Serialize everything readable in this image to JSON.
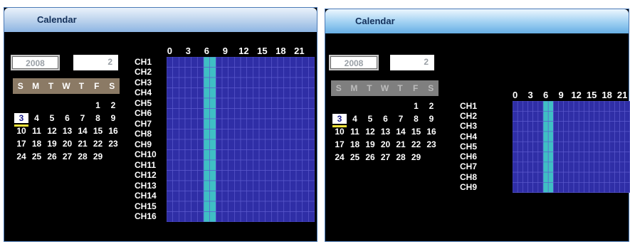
{
  "colors": {
    "cell_unscheduled": "#2f2ea6",
    "cell_scheduled": "#3fbfc4",
    "grid_line": "#5e5ccf",
    "dow_bg_left": "#8b7a65",
    "dow_bg_right": "#7f7f7f",
    "selected_underline": "#f2e23a"
  },
  "left": {
    "title": "Calendar",
    "year": "2008",
    "month": "2",
    "dow": [
      "S",
      "M",
      "T",
      "W",
      "T",
      "F",
      "S"
    ],
    "weeks": [
      [
        "",
        "",
        "",
        "",
        "",
        "1",
        "2"
      ],
      [
        "3",
        "4",
        "5",
        "6",
        "7",
        "8",
        "9"
      ],
      [
        "10",
        "11",
        "12",
        "13",
        "14",
        "15",
        "16"
      ],
      [
        "17",
        "18",
        "19",
        "20",
        "21",
        "22",
        "23"
      ],
      [
        "24",
        "25",
        "26",
        "27",
        "28",
        "29",
        ""
      ]
    ],
    "selected_day": "3",
    "hour_labels": [
      "0",
      "3",
      "6",
      "9",
      "12",
      "15",
      "18",
      "21"
    ],
    "channels": [
      "CH1",
      "CH2",
      "CH3",
      "CH4",
      "CH5",
      "CH6",
      "CH7",
      "CH8",
      "CH9",
      "CH10",
      "CH11",
      "CH12",
      "CH13",
      "CH14",
      "CH15",
      "CH16"
    ],
    "scheduled_hours": [
      6,
      7
    ]
  },
  "right": {
    "title": "Calendar",
    "year": "2008",
    "month": "2",
    "dow": [
      "S",
      "M",
      "T",
      "W",
      "T",
      "F",
      "S"
    ],
    "weeks": [
      [
        "",
        "",
        "",
        "",
        "",
        "1",
        "2"
      ],
      [
        "3",
        "4",
        "5",
        "6",
        "7",
        "8",
        "9"
      ],
      [
        "10",
        "11",
        "12",
        "13",
        "14",
        "15",
        "16"
      ],
      [
        "17",
        "18",
        "19",
        "20",
        "21",
        "22",
        "23"
      ],
      [
        "24",
        "25",
        "26",
        "27",
        "28",
        "29",
        ""
      ]
    ],
    "selected_day": "3",
    "hour_labels": [
      "0",
      "3",
      "6",
      "9",
      "12",
      "15",
      "18",
      "21"
    ],
    "channels": [
      "CH1",
      "CH2",
      "CH3",
      "CH4",
      "CH5",
      "CH6",
      "CH7",
      "CH8",
      "CH9"
    ],
    "scheduled_hours": [
      6,
      7
    ]
  }
}
